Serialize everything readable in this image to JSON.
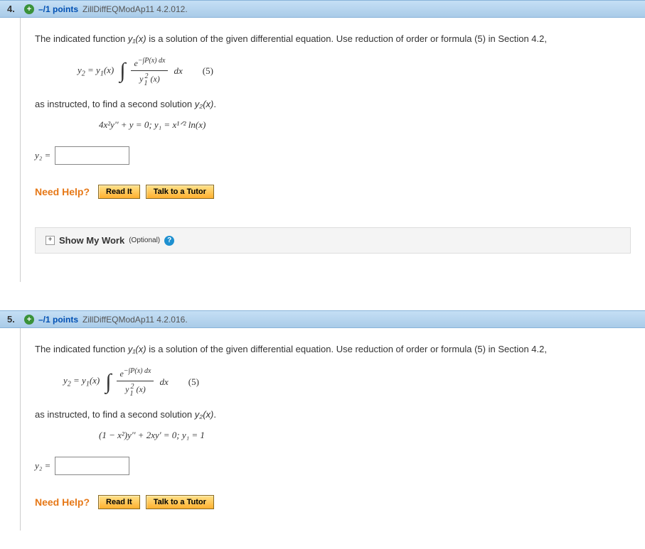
{
  "questions": [
    {
      "number": "4.",
      "points": "–/1 points",
      "source": "ZillDiffEQModAp11 4.2.012.",
      "prompt_a": "The indicated function ",
      "prompt_b": " is a solution of the given differential equation. Use reduction of order or formula (5) in Section 4.2,",
      "formula_lhs": "y",
      "formula_sub": "2",
      "formula_eq": " = y",
      "formula_sub1": "1",
      "formula_xparen": "(x)",
      "frac_num_a": "e",
      "frac_num_sup": "−∫P(x) dx",
      "frac_den_a": "y",
      "frac_den_sup": "2",
      "frac_den_sub": "1",
      "frac_den_b": "(x)",
      "dx": "dx",
      "eq_label": "(5)",
      "instruct2_a": "as instructed, to find a second solution ",
      "instruct2_b": ".",
      "given_eq": "4x²y'' + y = 0;    y₁ = x¹ᐟ² ln(x)",
      "answer_label": "y₂ = ",
      "need_help": "Need Help?",
      "read_it": "Read It",
      "tutor": "Talk to a Tutor",
      "show_work": "Show My Work",
      "optional": "(Optional)"
    },
    {
      "number": "5.",
      "points": "–/1 points",
      "source": "ZillDiffEQModAp11 4.2.016.",
      "prompt_a": "The indicated function ",
      "prompt_b": " is a solution of the given differential equation. Use reduction of order or formula (5) in Section 4.2,",
      "formula_lhs": "y",
      "formula_sub": "2",
      "formula_eq": " = y",
      "formula_sub1": "1",
      "formula_xparen": "(x)",
      "frac_num_a": "e",
      "frac_num_sup": "−∫P(x) dx",
      "frac_den_a": "y",
      "frac_den_sup": "2",
      "frac_den_sub": "1",
      "frac_den_b": "(x)",
      "dx": "dx",
      "eq_label": "(5)",
      "instruct2_a": "as instructed, to find a second solution ",
      "instruct2_b": ".",
      "given_eq": "(1 − x²)y'' + 2xy' = 0;    y₁ = 1",
      "answer_label": "y₂ = ",
      "need_help": "Need Help?",
      "read_it": "Read It",
      "tutor": "Talk to a Tutor"
    }
  ],
  "y1x": "y₁(x)",
  "y2x": "y₂(x)"
}
